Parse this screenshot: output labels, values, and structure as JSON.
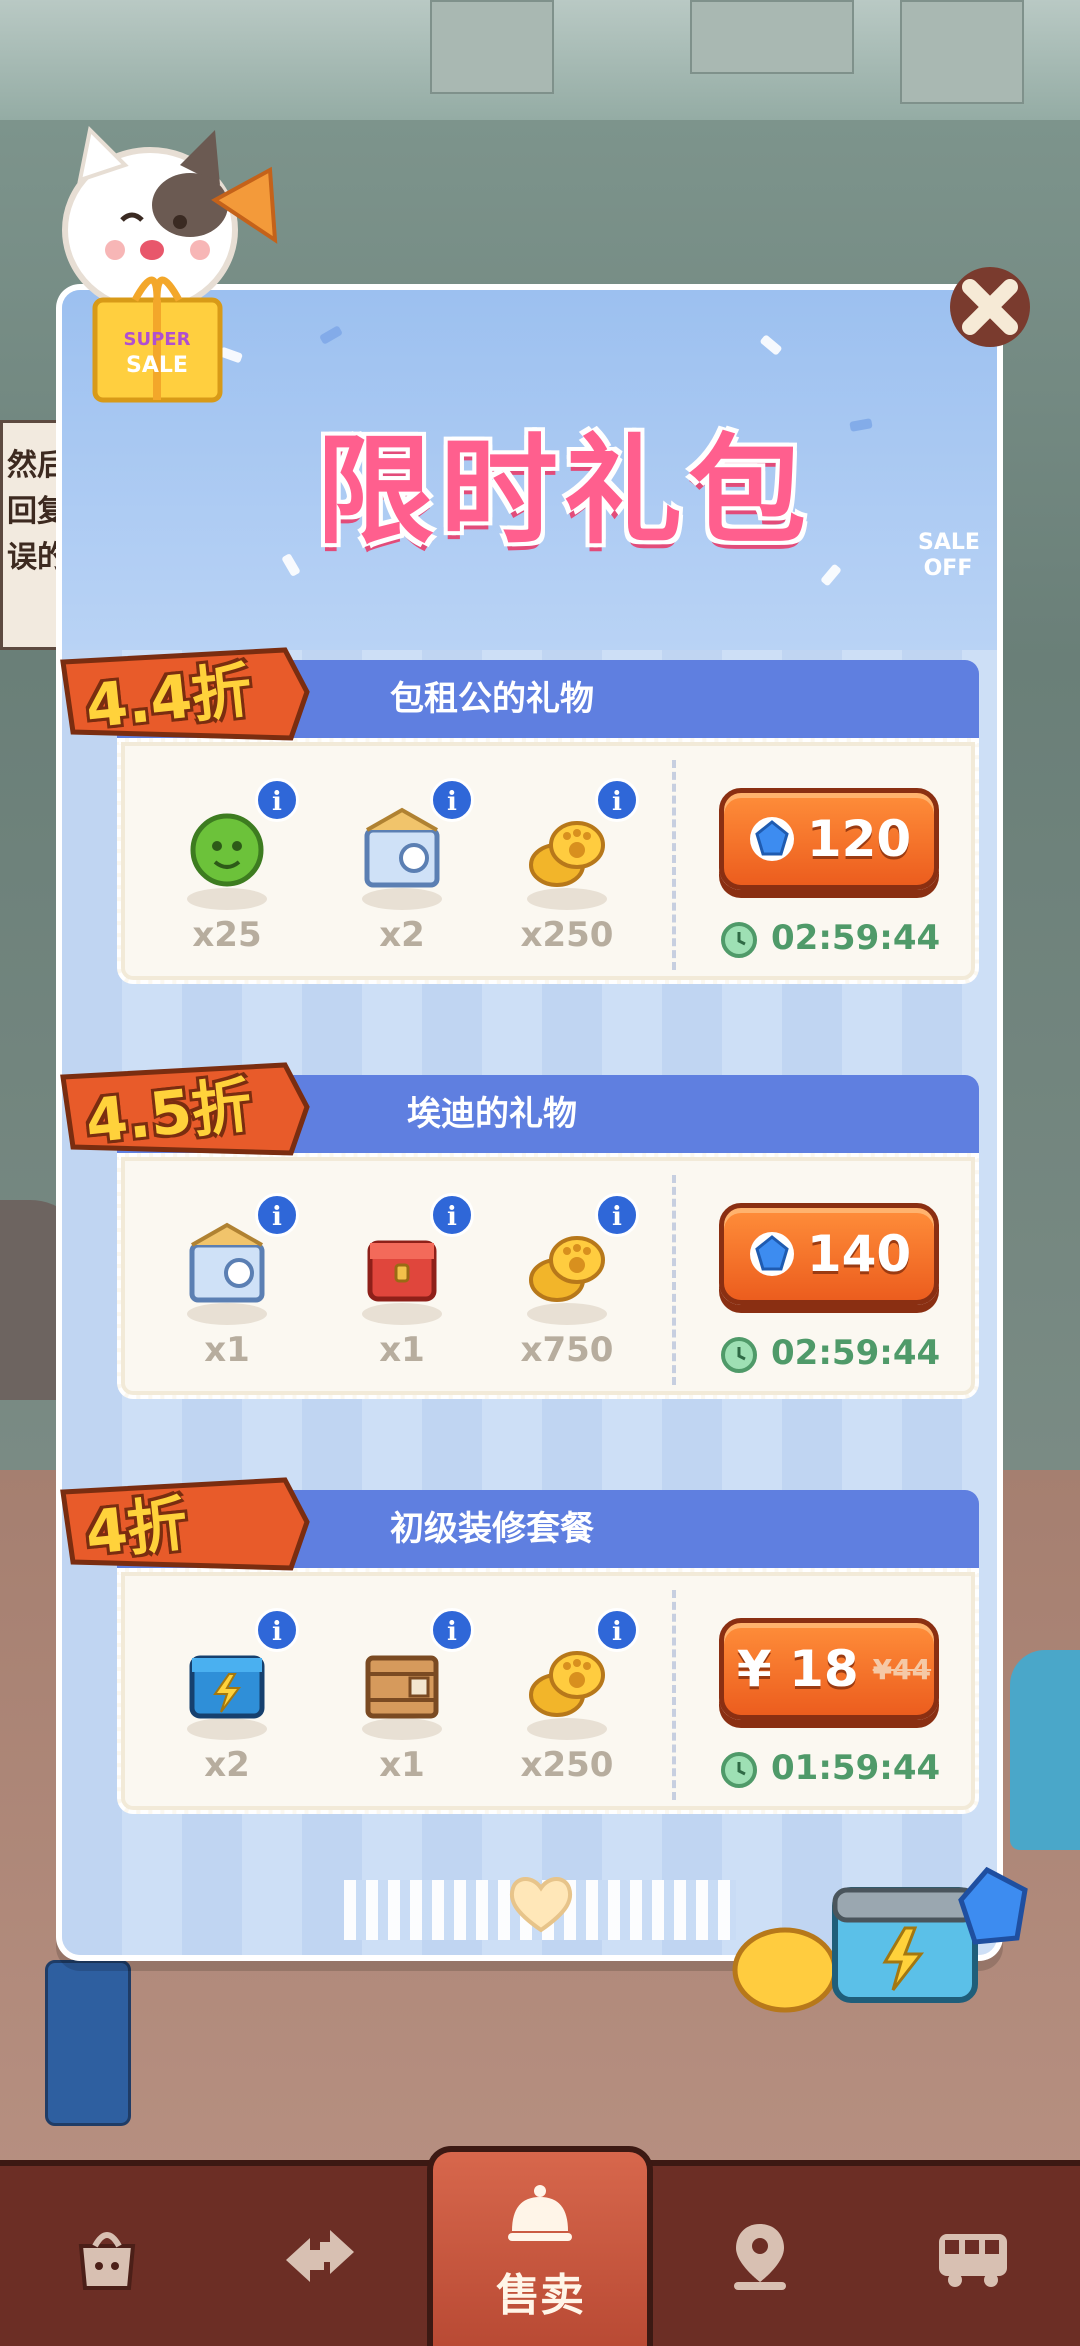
{
  "title": "限时礼包",
  "sale_off": "SALE OFF",
  "mascot": {
    "badge_top": "SUPER",
    "badge_bottom": "SALE"
  },
  "background_sign_lines": [
    "然后爱",
    "回复一",
    "误的告"
  ],
  "packages": [
    {
      "discount": "4.4折",
      "name": "包租公的礼物",
      "items": [
        {
          "icon": "green-button-icon",
          "qty": "x25"
        },
        {
          "icon": "blue-crate-icon",
          "qty": "x2"
        },
        {
          "icon": "paw-coins-icon",
          "qty": "x250"
        }
      ],
      "price": "120",
      "price_type": "gem",
      "timer": "02:59:44"
    },
    {
      "discount": "4.5折",
      "name": "埃迪的礼物",
      "items": [
        {
          "icon": "blue-crate-icon",
          "qty": "x1"
        },
        {
          "icon": "red-chest-icon",
          "qty": "x1"
        },
        {
          "icon": "paw-coins-icon",
          "qty": "x750"
        }
      ],
      "price": "140",
      "price_type": "gem",
      "timer": "02:59:44"
    },
    {
      "discount": "4折",
      "name": "初级装修套餐",
      "items": [
        {
          "icon": "blue-lightning-box-icon",
          "qty": "x2"
        },
        {
          "icon": "wooden-crate-icon",
          "qty": "x1"
        },
        {
          "icon": "paw-coins-icon",
          "qty": "x250"
        }
      ],
      "price": "¥ 18",
      "price_old": "¥44",
      "price_type": "cash",
      "timer": "01:59:44"
    }
  ],
  "bottom_nav": [
    {
      "icon": "cat-bag-icon",
      "label": ""
    },
    {
      "icon": "arrows-icon",
      "label": ""
    },
    {
      "icon": "service-bell-icon",
      "label": "售卖",
      "active": true
    },
    {
      "icon": "location-pin-icon",
      "label": ""
    },
    {
      "icon": "bus-icon",
      "label": ""
    }
  ],
  "colors": {
    "title_pink": "#ff5f8e",
    "header_blue": "#5f7fe0",
    "price_orange": "#ec5d1e",
    "timer_green": "#4f9a69",
    "nav_brown": "#6c2e25"
  }
}
